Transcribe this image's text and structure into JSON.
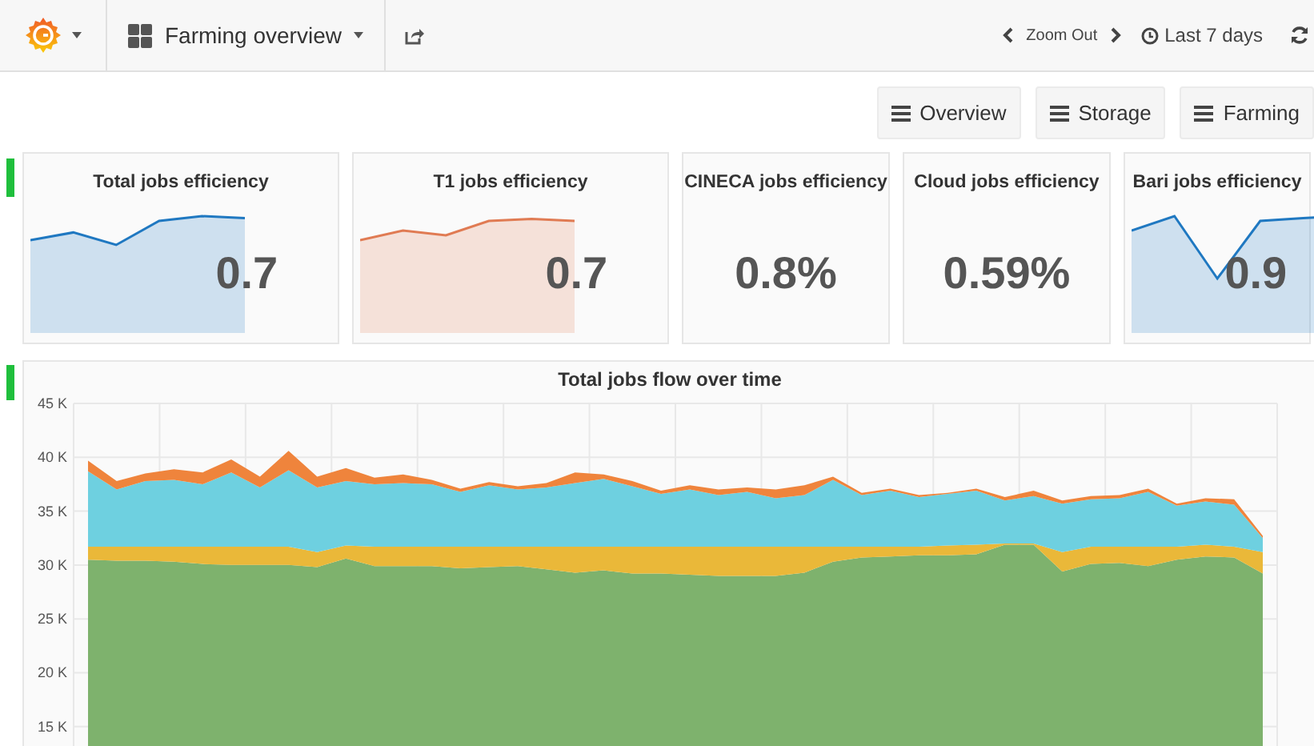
{
  "navbar": {
    "dashboard_title": "Farming overview",
    "zoom_label": "Zoom Out",
    "time_range": "Last 7 days"
  },
  "link_buttons": [
    "Overview",
    "Storage",
    "Farming"
  ],
  "stat_panels": [
    {
      "title": "Total jobs efficiency",
      "value": "0.7",
      "kind": "sparkline",
      "color": "#1f78c1"
    },
    {
      "title": "T1 jobs efficiency",
      "value": "0.7",
      "kind": "sparkline",
      "color": "#e07b53"
    },
    {
      "title": "CINECA jobs efficiency",
      "value": "0.8%",
      "kind": "plain"
    },
    {
      "title": "Cloud jobs efficiency",
      "value": "0.59%",
      "kind": "plain"
    },
    {
      "title": "Bari jobs efficiency",
      "value": "0.9",
      "kind": "sparkline",
      "color": "#1f78c1"
    }
  ],
  "graph_panel": {
    "title": "Total jobs flow over time",
    "chart_data": {
      "type": "area",
      "grid": true,
      "ylim": [
        13.2,
        45
      ],
      "yticks": [
        {
          "value": 15,
          "label": "15 K"
        },
        {
          "value": 20,
          "label": "20 K"
        },
        {
          "value": 25,
          "label": "25 K"
        },
        {
          "value": 30,
          "label": "30 K"
        },
        {
          "value": 35,
          "label": "35 K"
        },
        {
          "value": 40,
          "label": "40 K"
        },
        {
          "value": 45,
          "label": "45 K"
        }
      ],
      "series": [
        {
          "color": "#7eb26d",
          "values": [
            30.5,
            30.4,
            30.4,
            30.3,
            30.1,
            30.0,
            30.0,
            30.0,
            29.8,
            30.6,
            29.9,
            29.9,
            29.9,
            29.7,
            29.8,
            29.9,
            29.6,
            29.3,
            29.5,
            29.2,
            29.2,
            29.1,
            29.0,
            29.0,
            29.0,
            29.3,
            30.3,
            30.7,
            30.8,
            30.9,
            30.9,
            31.0,
            31.9,
            31.9,
            29.4,
            30.1,
            30.2,
            29.9,
            30.5,
            30.8,
            30.7,
            29.2
          ]
        },
        {
          "color": "#eab839",
          "values": [
            31.7,
            31.7,
            31.7,
            31.7,
            31.7,
            31.7,
            31.7,
            31.7,
            31.2,
            31.8,
            31.7,
            31.7,
            31.7,
            31.7,
            31.7,
            31.7,
            31.7,
            31.7,
            31.7,
            31.7,
            31.7,
            31.7,
            31.7,
            31.7,
            31.7,
            31.7,
            31.7,
            31.7,
            31.7,
            31.7,
            31.8,
            31.9,
            32.0,
            32.0,
            31.2,
            31.7,
            31.7,
            31.7,
            31.7,
            31.9,
            31.7,
            31.2
          ]
        },
        {
          "color": "#6ed0e0",
          "values": [
            38.7,
            37.0,
            37.8,
            37.9,
            37.5,
            38.6,
            37.2,
            38.8,
            37.2,
            37.8,
            37.5,
            37.6,
            37.5,
            36.8,
            37.4,
            37.0,
            37.2,
            37.6,
            38.0,
            37.3,
            36.6,
            37.0,
            36.5,
            36.8,
            36.2,
            36.5,
            37.9,
            36.5,
            36.9,
            36.3,
            36.6,
            36.9,
            36.0,
            36.4,
            35.7,
            36.1,
            36.2,
            36.8,
            35.5,
            35.9,
            35.6,
            32.5
          ]
        },
        {
          "color": "#ef843c",
          "values": [
            39.7,
            37.8,
            38.5,
            38.9,
            38.6,
            39.8,
            38.2,
            40.6,
            38.2,
            39.0,
            38.1,
            38.4,
            37.9,
            37.1,
            37.7,
            37.3,
            37.6,
            38.6,
            38.4,
            37.8,
            36.9,
            37.4,
            37.0,
            37.2,
            37.0,
            37.4,
            38.2,
            36.7,
            37.1,
            36.5,
            36.7,
            37.1,
            36.3,
            36.9,
            36.0,
            36.4,
            36.5,
            37.1,
            35.7,
            36.2,
            36.1,
            32.7
          ]
        }
      ]
    }
  }
}
